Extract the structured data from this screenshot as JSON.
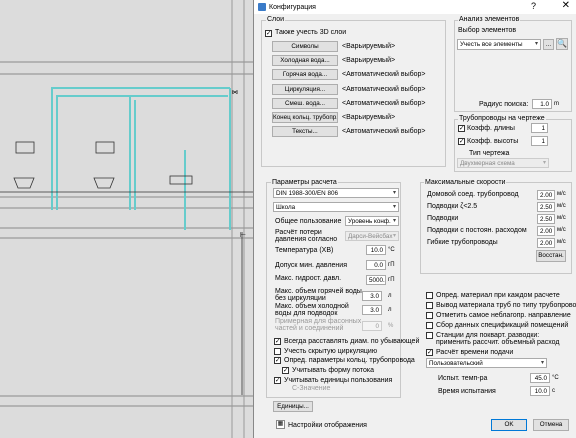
{
  "window": {
    "title": "Конфигурация",
    "help_label": "?",
    "close_label": "✕"
  },
  "layers": {
    "group_title": "Слои",
    "also_3d_label": "Также учесть 3D слои",
    "rows": [
      {
        "button": "Символы",
        "value": "<Варьируемый>"
      },
      {
        "button": "Холодная вода...",
        "value": "<Варьируемый>"
      },
      {
        "button": "Горячая вода...",
        "value": "<Автоматический выбор>"
      },
      {
        "button": "Циркуляция...",
        "value": "<Автоматический выбор>"
      },
      {
        "button": "Смеш. вода...",
        "value": "<Автоматический выбор>"
      },
      {
        "button": "Конец кольц. трубопр...",
        "value": "<Варьируемый>"
      },
      {
        "button": "Тексты...",
        "value": "<Автоматический выбор>"
      }
    ]
  },
  "analysis": {
    "group_title": "Анализ элементов",
    "select_label": "Выбор элементов",
    "select_value": "Учесть все элементы",
    "dots_label": "...",
    "radius_label": "Радиус поиска:",
    "radius_value": "1.0",
    "radius_unit": "m"
  },
  "pipes_drawing": {
    "group_title": "Трубопроводы на чертеже",
    "len_label": "Коэфф. длины",
    "len_value": "1",
    "height_label": "Коэфф. высоты",
    "height_value": "1",
    "type_label": "Тип чертежа",
    "type_value": "Двухмерная схема"
  },
  "calc": {
    "group_title": "Параметры расчета",
    "norm_value": "DIN 1988-300/EN 806",
    "building_value": "Школа",
    "usage_label": "Общее пользование",
    "usage_value": "Уровень конф.",
    "press_loss_label": "Расчёт потери давления согласно",
    "press_loss_value": "Дарси-Вейсбах",
    "temp_label": "Температура (ХВ)",
    "temp_value": "10.0",
    "temp_unit": "°C",
    "min_press_label": "Допуск мин. давления",
    "min_press_value": "0.0",
    "min_press_unit": "гП",
    "max_press_label": "Макс. гидрост. давл.",
    "max_press_value": "5000.0",
    "max_press_unit": "гП",
    "hot_vol_label": "Макс. объем горячей воды без циркуляции",
    "hot_vol_value": "3.0",
    "hot_vol_unit": "л",
    "cold_vol_label": "Макс. объем холодной воды для подводок",
    "cold_vol_value": "3.0",
    "cold_vol_unit": "л",
    "approx_label": "Примерная для фасонных частей и соединений",
    "approx_value": "0",
    "approx_unit": "%",
    "checks": [
      {
        "label": "Всегда расставлять диам. по убывающей",
        "on": true
      },
      {
        "label": "Учесть скрытую циркуляцию",
        "on": false
      },
      {
        "label": "Опред. параметры кольц. трубопровода",
        "on": true
      },
      {
        "label": "Учитывать форму потока",
        "on": true
      },
      {
        "label": "Учитывать единицы пользования",
        "on": true
      }
    ],
    "c_value_label": "C-Значение",
    "units_button": "Единицы..."
  },
  "velocity": {
    "group_title": "Максимальные скорости",
    "rows": [
      {
        "label": "Домовой соед. трубопровод",
        "value": "2.00",
        "unit": "м/с"
      },
      {
        "label": "Подводки ζ<2.5",
        "value": "2.50",
        "unit": "м/с"
      },
      {
        "label": "Подводки",
        "value": "2.50",
        "unit": "м/с"
      },
      {
        "label": "Подводки с постоян. расходом",
        "value": "2.00",
        "unit": "м/с"
      },
      {
        "label": "Гибкие трубопроводы",
        "value": "2.00",
        "unit": "м/с"
      }
    ],
    "restore_button": "Восстан."
  },
  "options": {
    "checks": [
      {
        "label": "Опред. материал при каждом расчете",
        "on": false
      },
      {
        "label": "Вывод материала труб по типу трубопровода",
        "on": false
      },
      {
        "label": "Отметить самое неблагопр. направление",
        "on": false
      },
      {
        "label": "Сбор данных спецификаций помещений",
        "on": false
      },
      {
        "label": "Станции для покварт. разводки: применить рассчит. объемный расход",
        "on": false
      },
      {
        "label": "Расчёт времени подачи",
        "on": true
      }
    ],
    "mode_value": "Пользовательский",
    "test_temp_label": "Испыт. темп-ра",
    "test_temp_value": "45.0",
    "test_temp_unit": "°C",
    "test_time_label": "Время испытания",
    "test_time_value": "10.0",
    "test_time_unit": "с"
  },
  "footer": {
    "display_settings_label": "Настройки отображения",
    "ok_label": "OK",
    "cancel_label": "Отмена"
  },
  "colors": {
    "cad_pipe": "#66cccc",
    "cad_line": "#222222",
    "dialog_bg": "#f0f0f0",
    "accent": "#0078d7"
  }
}
